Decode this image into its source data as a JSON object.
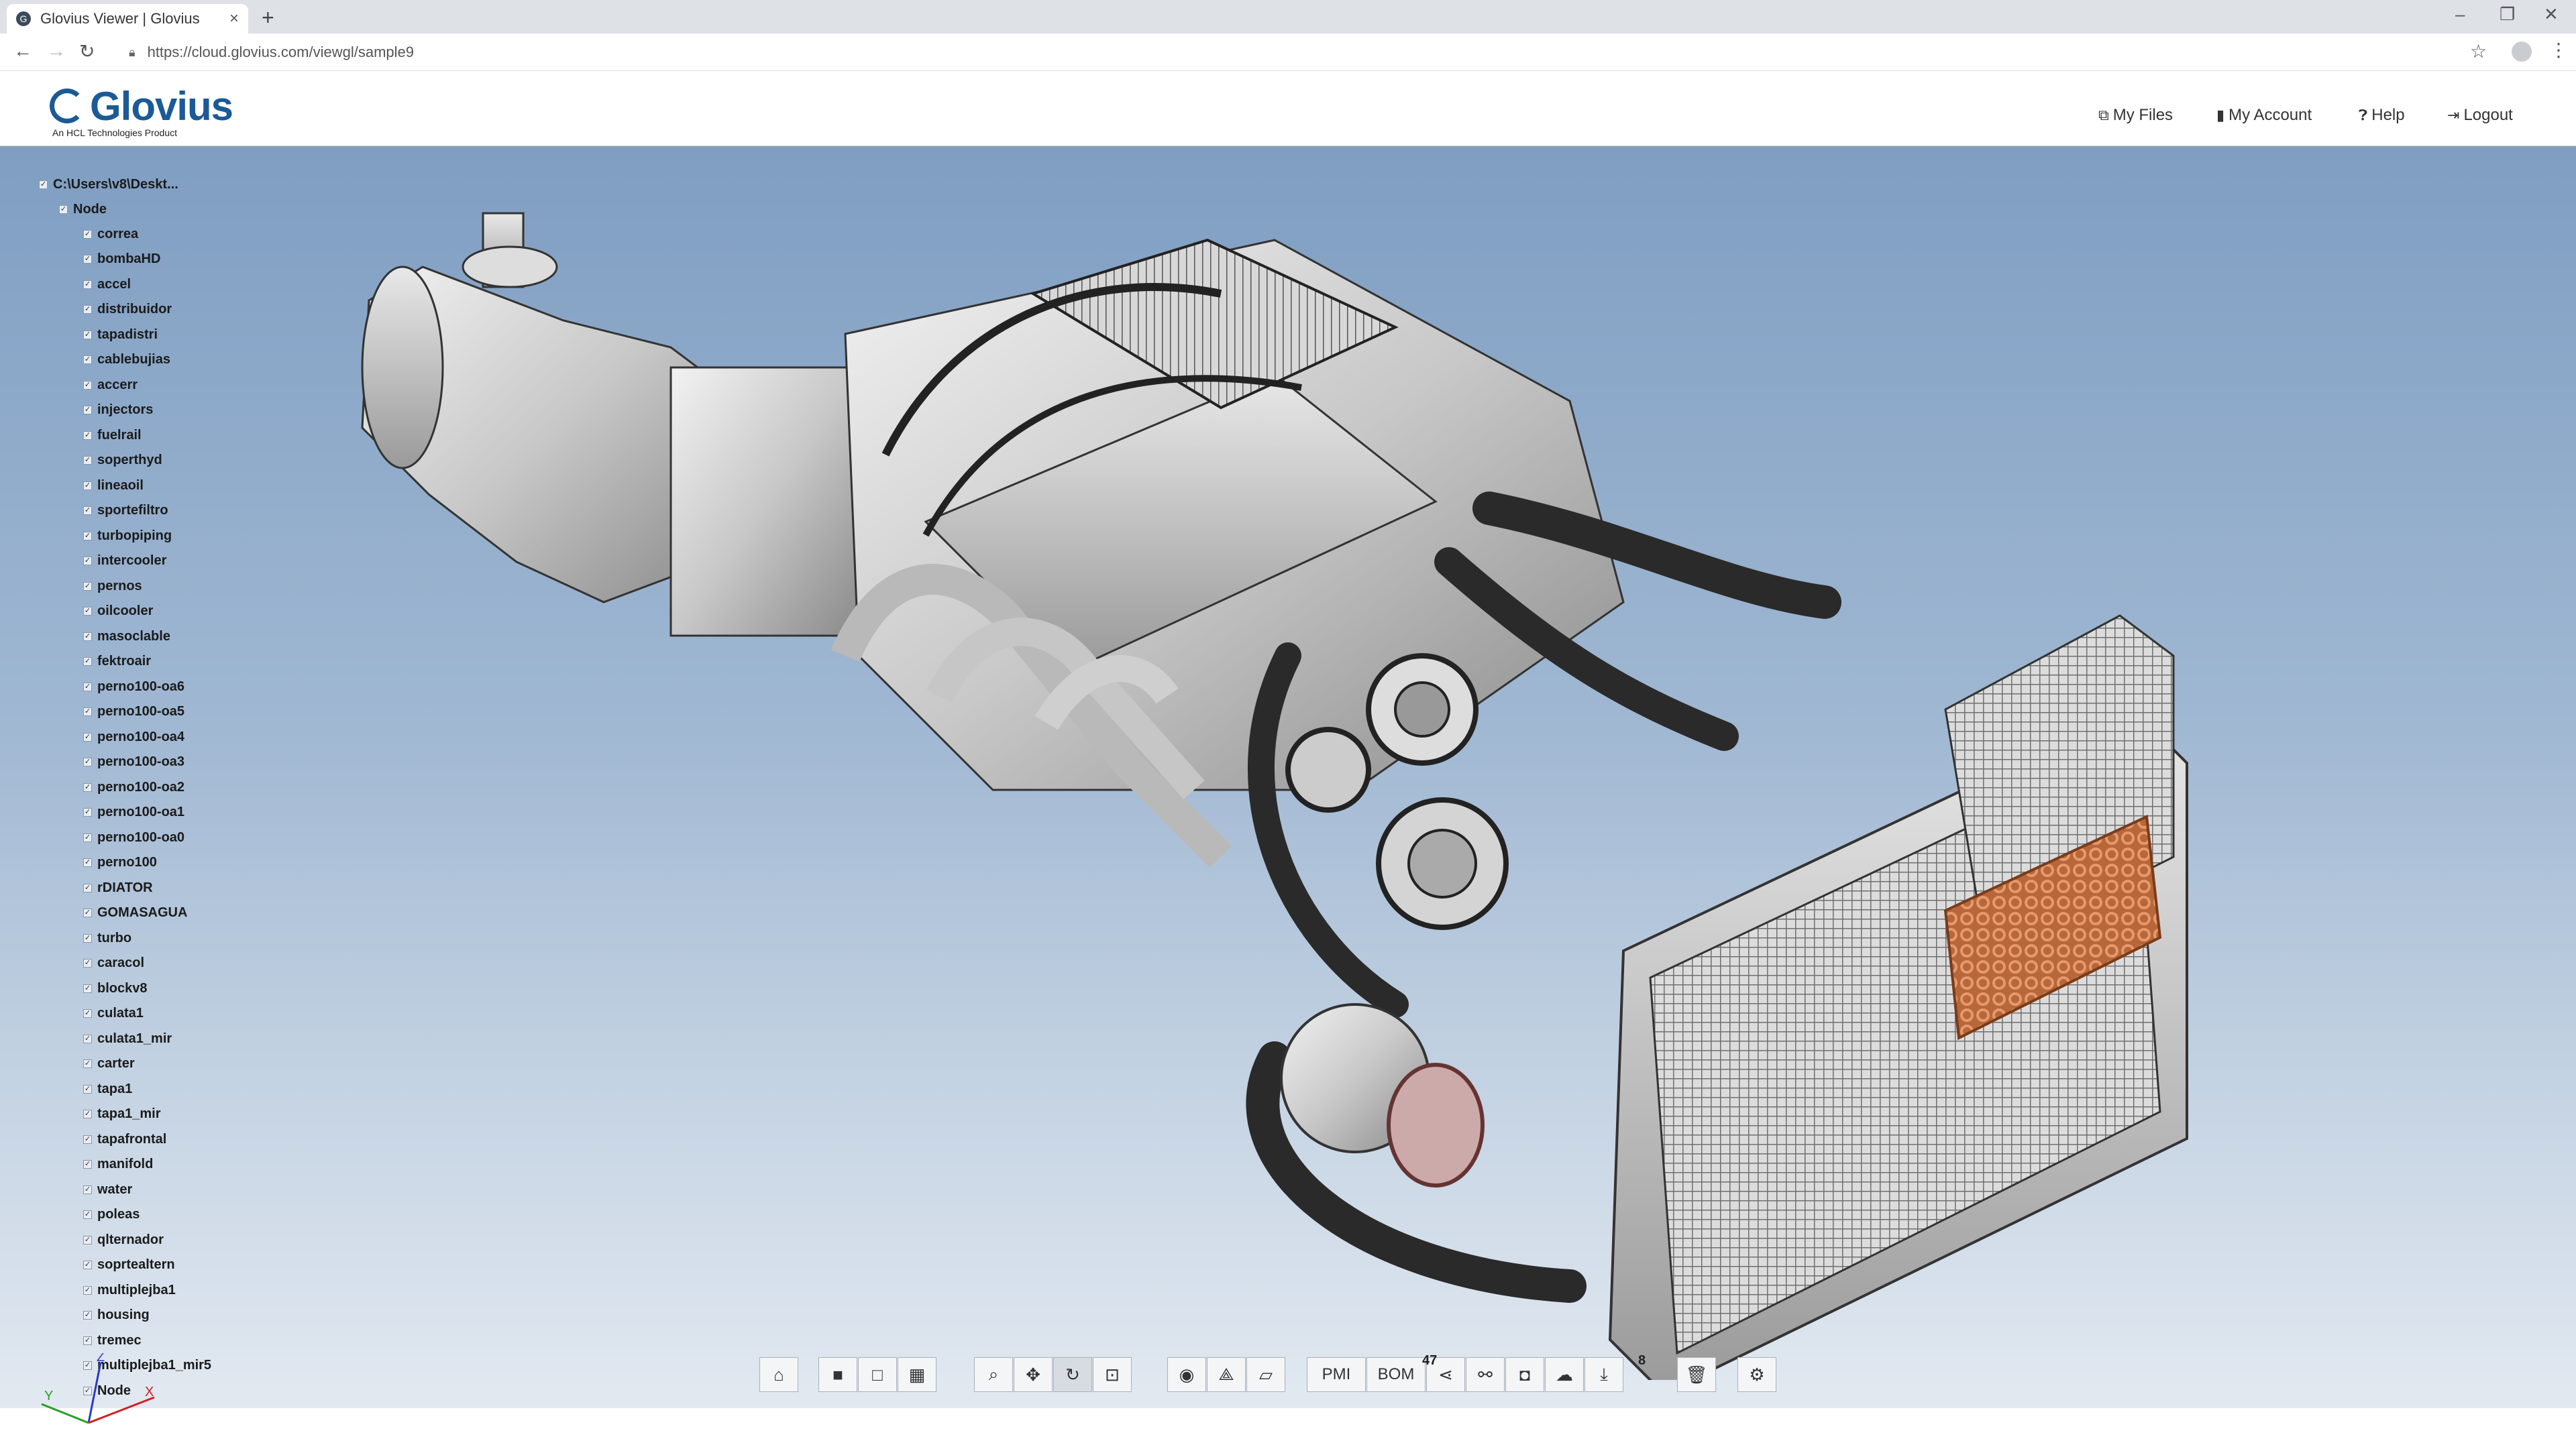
{
  "browser": {
    "tab_title": "Glovius Viewer | Glovius",
    "tab_close": "×",
    "new_tab": "+",
    "url": "https://cloud.glovius.com/viewgl/sample9"
  },
  "header": {
    "brand": "Glovius",
    "tagline": "An HCL Technologies Product",
    "nav": {
      "my_files": "My Files",
      "my_account": "My Account",
      "help": "Help",
      "logout": "Logout"
    }
  },
  "tree": {
    "root": "C:\\Users\\v8\\Deskt...",
    "node": "Node",
    "items": [
      "correa",
      "bombaHD",
      "accel",
      "distribuidor",
      "tapadistri",
      "cablebujias",
      "accerr",
      "injectors",
      "fuelrail",
      "soperthyd",
      "lineaoil",
      "sportefiltro",
      "turbopiping",
      "intercooler",
      "pernos",
      "oilcooler",
      "masoclable",
      "fektroair",
      "perno100-oa6",
      "perno100-oa5",
      "perno100-oa4",
      "perno100-oa3",
      "perno100-oa2",
      "perno100-oa1",
      "perno100-oa0",
      "perno100",
      "rDIATOR",
      "GOMASAGUA",
      "turbo",
      "caracol",
      "blockv8",
      "culata1",
      "culata1_mir",
      "carter",
      "tapa1",
      "tapa1_mir",
      "tapafrontal",
      "manifold",
      "water",
      "poleas",
      "qlternador",
      "soprtealtern",
      "multiplejba1",
      "housing",
      "tremec",
      "multiplejba1_mir5",
      "Node"
    ]
  },
  "axes": {
    "x": "X",
    "y": "Y",
    "z": "Z"
  },
  "toolbar": {
    "pmi": "PMI",
    "bom": "BOM",
    "bom_badge": "47",
    "download_badge": "8",
    "icons": [
      "home-icon",
      "solid-cube-icon",
      "wire-cube-icon",
      "layers-icon",
      "zoom-icon",
      "pan-icon",
      "rotate-icon",
      "zoom-fit-icon",
      "section-icon",
      "measure-icon",
      "notes-icon",
      "share-icon",
      "link-icon",
      "camera-icon",
      "comment-icon",
      "download-icon",
      "delete-icon",
      "settings-icon"
    ]
  },
  "colors": {
    "brand": "#1b5a96",
    "viewer_top": "#7f9ec2",
    "viewer_bottom": "#e2e9f1"
  }
}
